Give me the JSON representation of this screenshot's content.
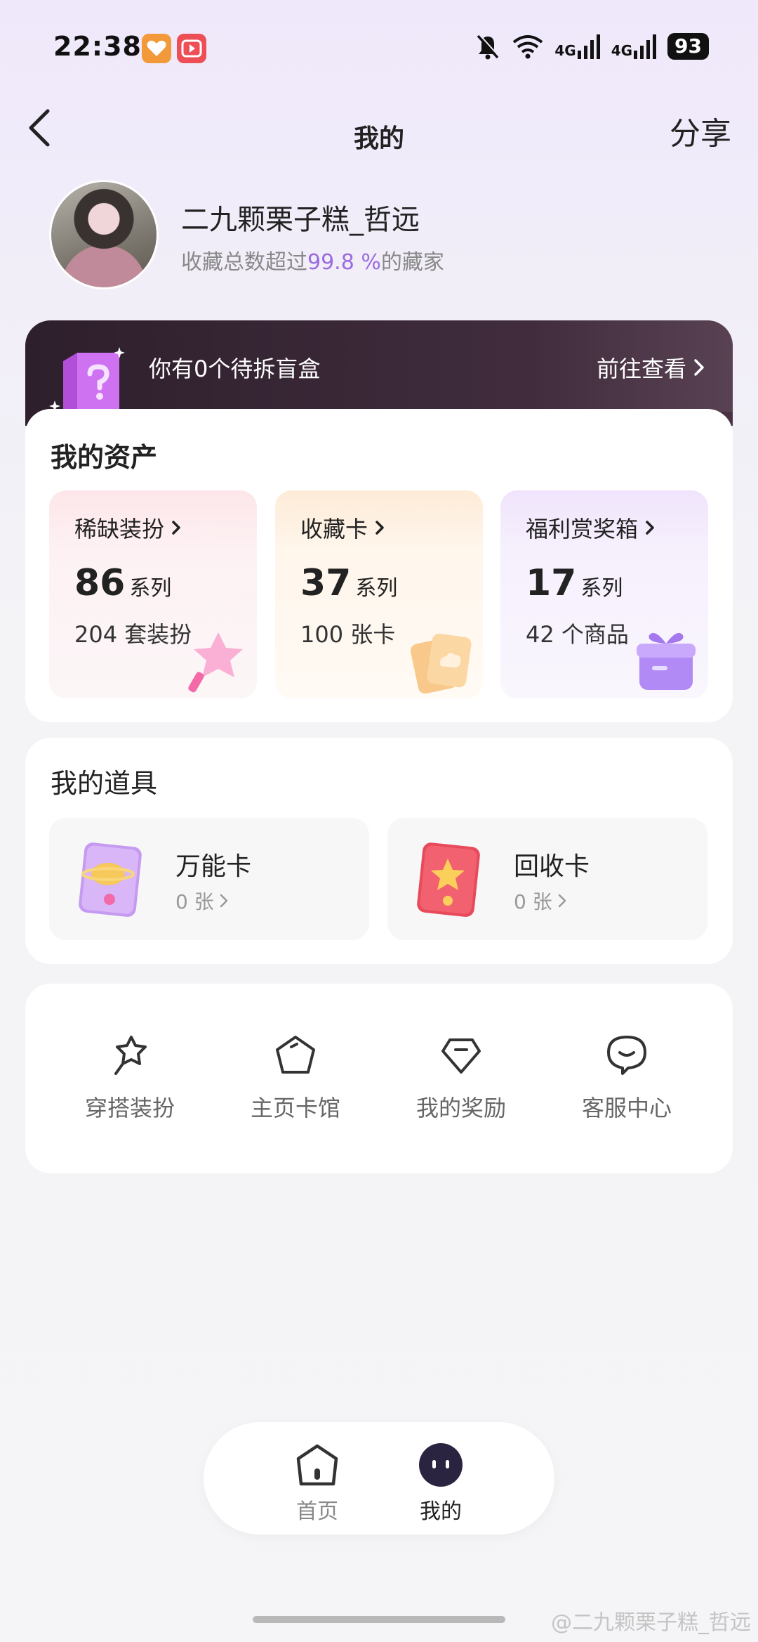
{
  "status_bar": {
    "time": "22:38",
    "signal_1": "4G",
    "signal_2": "4G",
    "battery": "93"
  },
  "header": {
    "title": "我的",
    "share_label": "分享"
  },
  "profile": {
    "username": "二九颗栗子糕_哲远",
    "subtitle_prefix": "收藏总数超过",
    "subtitle_percent": "99.8 %",
    "subtitle_suffix": "的藏家"
  },
  "banner": {
    "text": "你有0个待拆盲盒",
    "link": "前往查看"
  },
  "assets": {
    "title": "我的资产",
    "items": [
      {
        "label": "稀缺装扮",
        "count": "86",
        "unit": "系列",
        "sub": "204 套装扮"
      },
      {
        "label": "收藏卡",
        "count": "37",
        "unit": "系列",
        "sub": "100 张卡"
      },
      {
        "label": "福利赏奖箱",
        "count": "17",
        "unit": "系列",
        "sub": "42 个商品"
      }
    ]
  },
  "props": {
    "title": "我的道具",
    "items": [
      {
        "name": "万能卡",
        "count": "0 张"
      },
      {
        "name": "回收卡",
        "count": "0 张"
      }
    ]
  },
  "shortcuts": [
    {
      "label": "穿搭装扮",
      "icon": "outfit-icon"
    },
    {
      "label": "主页卡馆",
      "icon": "pentagon-icon"
    },
    {
      "label": "我的奖励",
      "icon": "diamond-icon"
    },
    {
      "label": "客服中心",
      "icon": "chat-icon"
    }
  ],
  "bottom_nav": {
    "home_label": "首页",
    "me_label": "我的"
  },
  "watermark": "@二九颗栗子糕_哲远",
  "colors": {
    "accent_purple": "#9b6be0",
    "banner_dark": "#2e1f2c"
  }
}
